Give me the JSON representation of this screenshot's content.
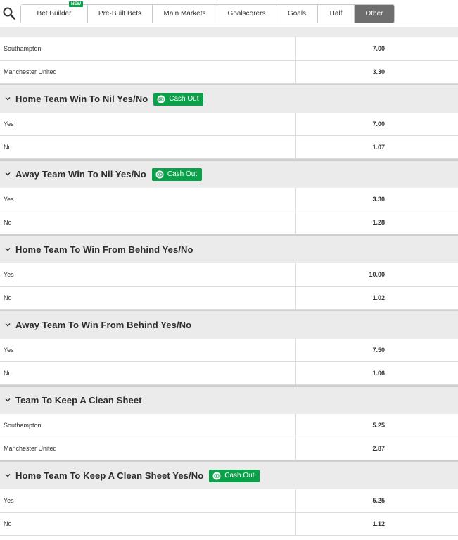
{
  "tabs": [
    {
      "label": "Bet Builder",
      "badge": "NEW",
      "width": 95
    },
    {
      "label": "Pre-Built Bets",
      "width": 92
    },
    {
      "label": "Main Markets",
      "width": 92
    },
    {
      "label": "Goalscorers",
      "width": 84
    },
    {
      "label": "Goals",
      "width": 59
    },
    {
      "label": "Half",
      "width": 52
    },
    {
      "label": "Other",
      "active": true,
      "width": 56
    }
  ],
  "cashout_label": "Cash Out",
  "sections": [
    {
      "title": "",
      "rows": [
        {
          "label": "Southampton",
          "odds": "7.00"
        },
        {
          "label": "Manchester United",
          "odds": "3.30"
        }
      ]
    },
    {
      "title": "Home Team Win To Nil Yes/No",
      "cashout": true,
      "rows": [
        {
          "label": "Yes",
          "odds": "7.00"
        },
        {
          "label": "No",
          "odds": "1.07"
        }
      ]
    },
    {
      "title": "Away Team Win To Nil Yes/No",
      "cashout": true,
      "rows": [
        {
          "label": "Yes",
          "odds": "3.30"
        },
        {
          "label": "No",
          "odds": "1.28"
        }
      ]
    },
    {
      "title": "Home Team To Win From Behind Yes/No",
      "cashout": false,
      "rows": [
        {
          "label": "Yes",
          "odds": "10.00"
        },
        {
          "label": "No",
          "odds": "1.02"
        }
      ]
    },
    {
      "title": "Away Team To Win From Behind Yes/No",
      "cashout": false,
      "rows": [
        {
          "label": "Yes",
          "odds": "7.50"
        },
        {
          "label": "No",
          "odds": "1.06"
        }
      ]
    },
    {
      "title": "Team To Keep A Clean Sheet",
      "cashout": false,
      "rows": [
        {
          "label": "Southampton",
          "odds": "5.25"
        },
        {
          "label": "Manchester United",
          "odds": "2.87"
        }
      ]
    },
    {
      "title": "Home Team To Keep A Clean Sheet Yes/No",
      "cashout": true,
      "rows": [
        {
          "label": "Yes",
          "odds": "5.25"
        },
        {
          "label": "No",
          "odds": "1.12"
        }
      ]
    }
  ],
  "colors": {
    "accent_green": "#0ba14b",
    "active_tab": "#6e6e6e",
    "header_bg": "#ebebeb"
  },
  "icons": {
    "search": "search-icon",
    "chevron": "chevron-down-icon",
    "cashout": "cashout-icon"
  }
}
